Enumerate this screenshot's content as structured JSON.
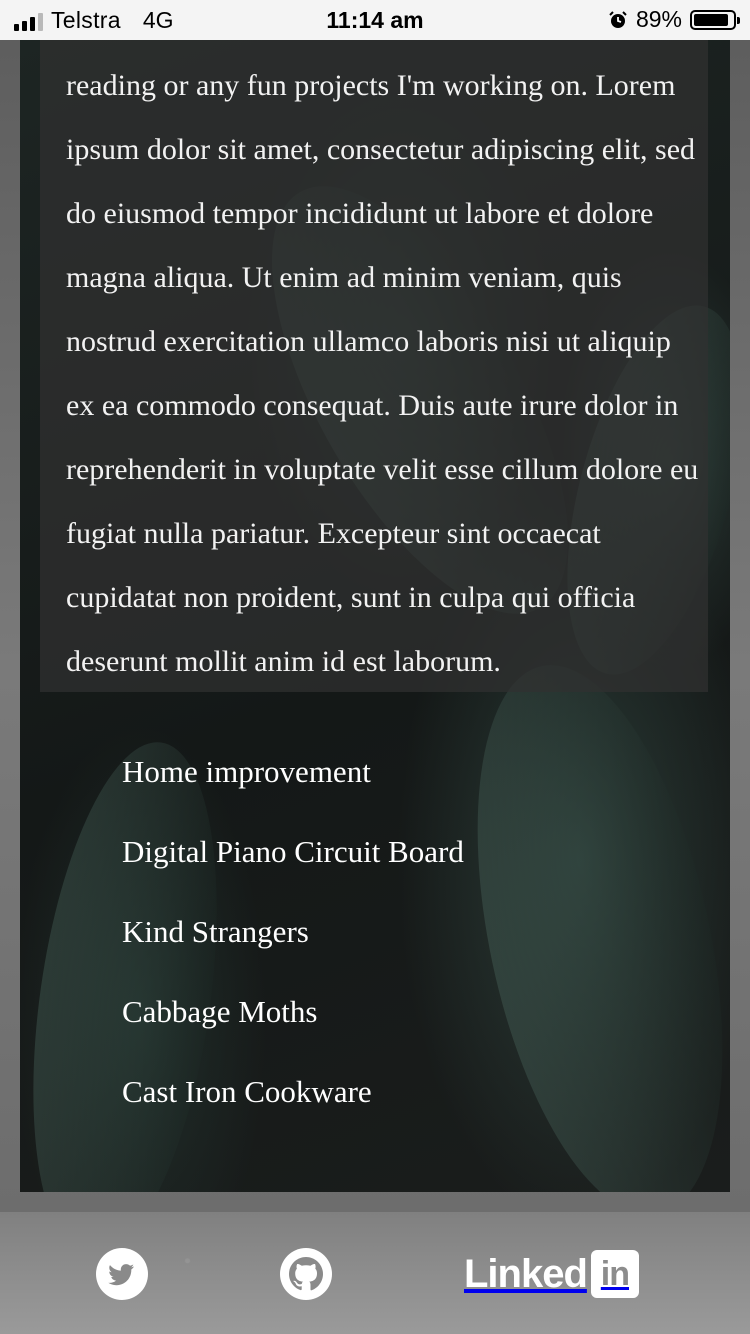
{
  "status_bar": {
    "carrier": "Telstra",
    "network": "4G",
    "time": "11:14 am",
    "battery_percent": "89%",
    "battery_level": 0.89,
    "alarm_icon": "alarm-clock-icon"
  },
  "about": {
    "body": "reading or any fun projects I'm working on. Lorem ipsum dolor sit amet, consectetur adipiscing elit, sed do eiusmod tempor incididunt ut labore et dolore magna aliqua. Ut enim ad minim veniam, quis nostrud exercitation ullamco laboris nisi ut aliquip ex ea commodo consequat. Duis aute irure dolor in reprehenderit in voluptate velit esse cillum dolore eu fugiat nulla pariatur. Excepteur sint occaecat cupidatat non proident, sunt in culpa qui officia deserunt mollit anim id est laborum."
  },
  "posts": [
    {
      "title": "Home improvement"
    },
    {
      "title": "Digital Piano Circuit Board"
    },
    {
      "title": "Kind Strangers"
    },
    {
      "title": "Cabbage Moths"
    },
    {
      "title": "Cast Iron Cookware"
    }
  ],
  "footer": {
    "social": [
      {
        "icon": "twitter-icon"
      },
      {
        "icon": "github-icon"
      },
      {
        "icon": "linkedin-icon",
        "word": "Linked",
        "box": "in"
      }
    ]
  }
}
